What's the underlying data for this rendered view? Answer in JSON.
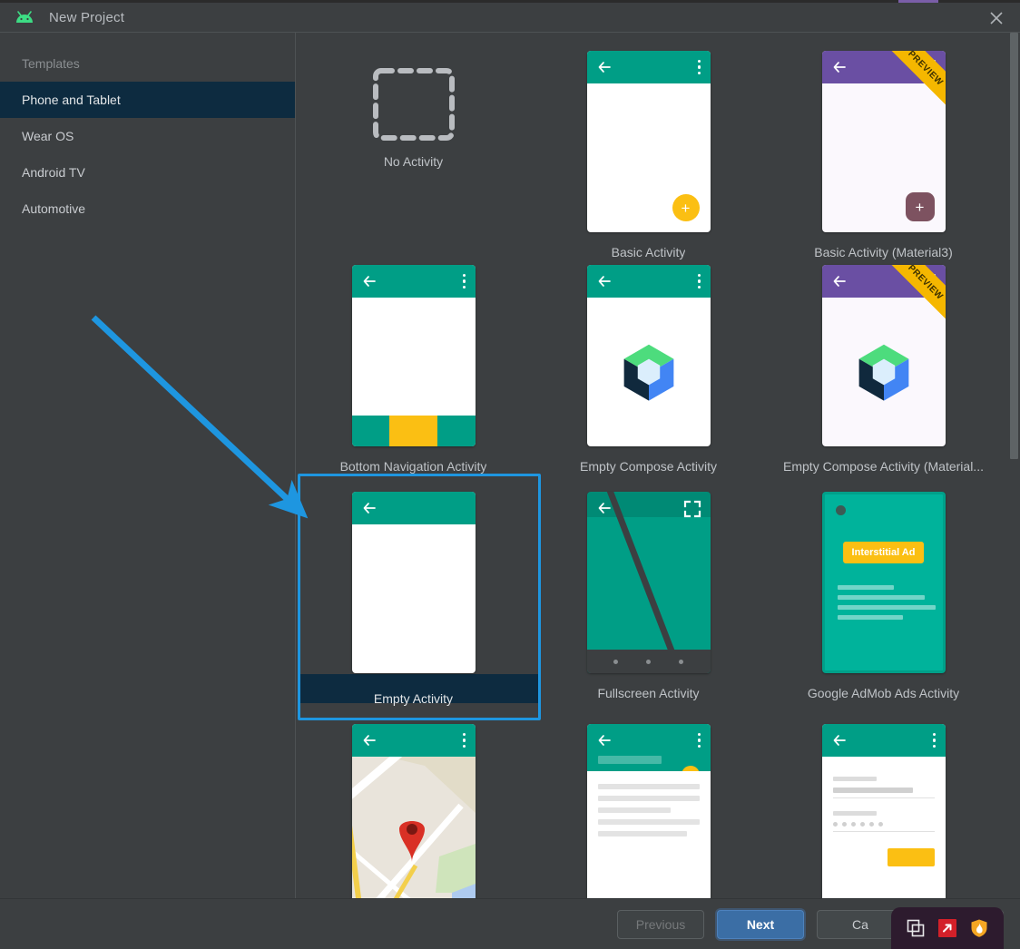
{
  "window": {
    "title": "New Project",
    "app_icon": "android-robot-icon",
    "close_icon": "close-icon"
  },
  "sidebar": {
    "group_label": "Templates",
    "items": [
      {
        "label": "Phone and Tablet",
        "selected": true
      },
      {
        "label": "Wear OS",
        "selected": false
      },
      {
        "label": "Android TV",
        "selected": false
      },
      {
        "label": "Automotive",
        "selected": false
      }
    ]
  },
  "templates": {
    "selected": "Empty Activity",
    "rows": [
      [
        {
          "label": "No Activity",
          "kind": "no-activity"
        },
        {
          "label": "Basic Activity",
          "kind": "basic"
        },
        {
          "label": "Basic Activity (Material3)",
          "kind": "basic-m3",
          "ribbon": "PREVIEW"
        }
      ],
      [
        {
          "label": "Bottom Navigation Activity",
          "kind": "bottom-nav"
        },
        {
          "label": "Empty Compose Activity",
          "kind": "compose"
        },
        {
          "label": "Empty Compose Activity (Material...",
          "kind": "compose-m3",
          "ribbon": "PREVIEW"
        }
      ],
      [
        {
          "label": "Empty Activity",
          "kind": "empty"
        },
        {
          "label": "Fullscreen Activity",
          "kind": "fullscreen"
        },
        {
          "label": "Google AdMob Ads Activity",
          "kind": "admob",
          "badge": "Interstitial Ad"
        }
      ],
      [
        {
          "label": "",
          "kind": "maps"
        },
        {
          "label": "",
          "kind": "list"
        },
        {
          "label": "",
          "kind": "login"
        }
      ]
    ]
  },
  "footer": {
    "previous_label": "Previous",
    "next_label": "Next",
    "cancel_label": "Ca",
    "fourth_label": ""
  },
  "overlay": {
    "icons": [
      {
        "name": "copy-windows-icon"
      },
      {
        "name": "screenshot-arrow-icon"
      },
      {
        "name": "shield-flame-icon"
      }
    ]
  },
  "annotation": {
    "arrow_color": "#1e96e0",
    "target": "Empty Activity"
  },
  "colors": {
    "accent_blue": "#1e96e0",
    "selection_navy": "#0d2b40",
    "teal": "#009e86",
    "purple": "#6a4fa3",
    "amber": "#fbbf13",
    "background": "#3c3f41"
  }
}
